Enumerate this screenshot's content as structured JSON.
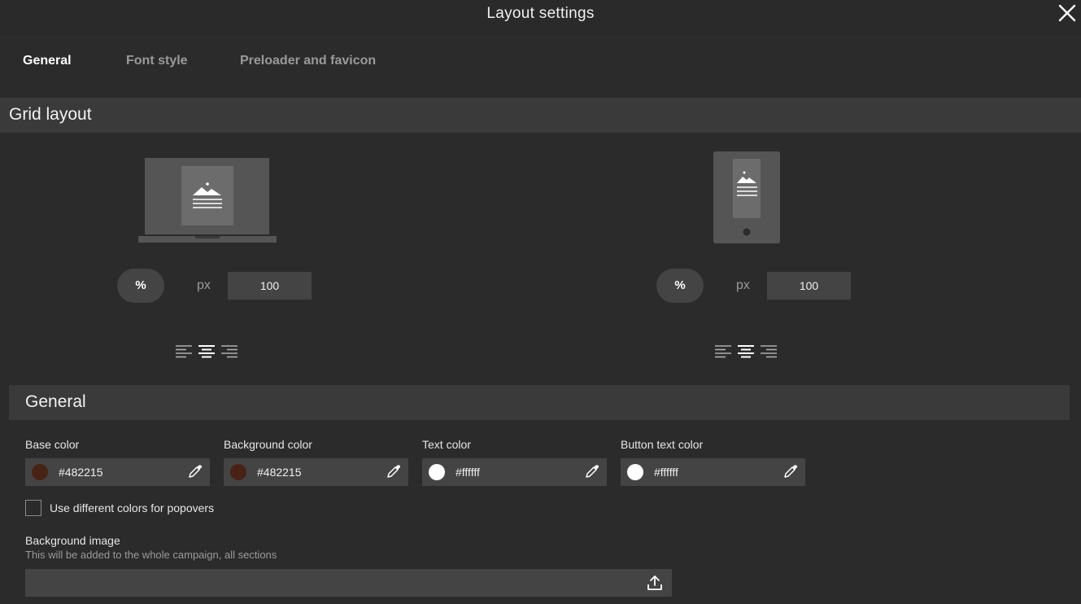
{
  "header": {
    "title": "Layout settings"
  },
  "tabs": [
    {
      "label": "General",
      "active": true
    },
    {
      "label": "Font style",
      "active": false
    },
    {
      "label": "Preloader and favicon",
      "active": false
    }
  ],
  "grid_layout": {
    "title": "Grid layout",
    "desktop": {
      "unit_percent": "%",
      "unit_px": "px",
      "value": "100",
      "selected_unit": "%",
      "alignment": "center"
    },
    "mobile": {
      "unit_percent": "%",
      "unit_px": "px",
      "value": "100",
      "selected_unit": "%",
      "alignment": "center"
    }
  },
  "general": {
    "title": "General",
    "colors": [
      {
        "label": "Base color",
        "value": "#482215",
        "swatch": "#482215"
      },
      {
        "label": "Background color",
        "value": "#482215",
        "swatch": "#482215"
      },
      {
        "label": "Text color",
        "value": "#ffffff",
        "swatch": "#ffffff"
      },
      {
        "label": "Button text color",
        "value": "#ffffff",
        "swatch": "#ffffff"
      }
    ],
    "popover_checkbox": {
      "label": "Use different colors for popovers",
      "checked": false
    },
    "background_image": {
      "label": "Background image",
      "hint": "This will be added to the whole campaign, all sections"
    }
  }
}
